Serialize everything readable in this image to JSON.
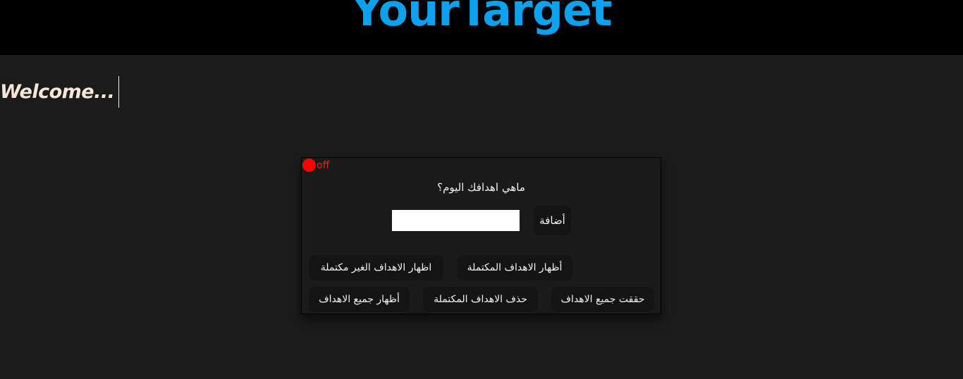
{
  "header": {
    "logo_text": "YourTarget",
    "logo_color": "#0aa2ef"
  },
  "welcome": {
    "text": "Welcome..."
  },
  "panel": {
    "toggle": {
      "label": "off",
      "color": "#ff0000"
    },
    "question": "ماهي اهدافك اليوم؟",
    "goal_input": {
      "value": "",
      "placeholder": ""
    },
    "buttons": {
      "add": "أضافة",
      "show_completed": "أظهار الاهداف المكتملة",
      "show_incomplete": "اظهار الاهداف الغير مكتملة",
      "mark_all_done": "حققت جميع الاهداف",
      "delete_completed": "حذف الاهداف المكتملة",
      "show_all": "أظهار جميع الاهداف"
    }
  }
}
